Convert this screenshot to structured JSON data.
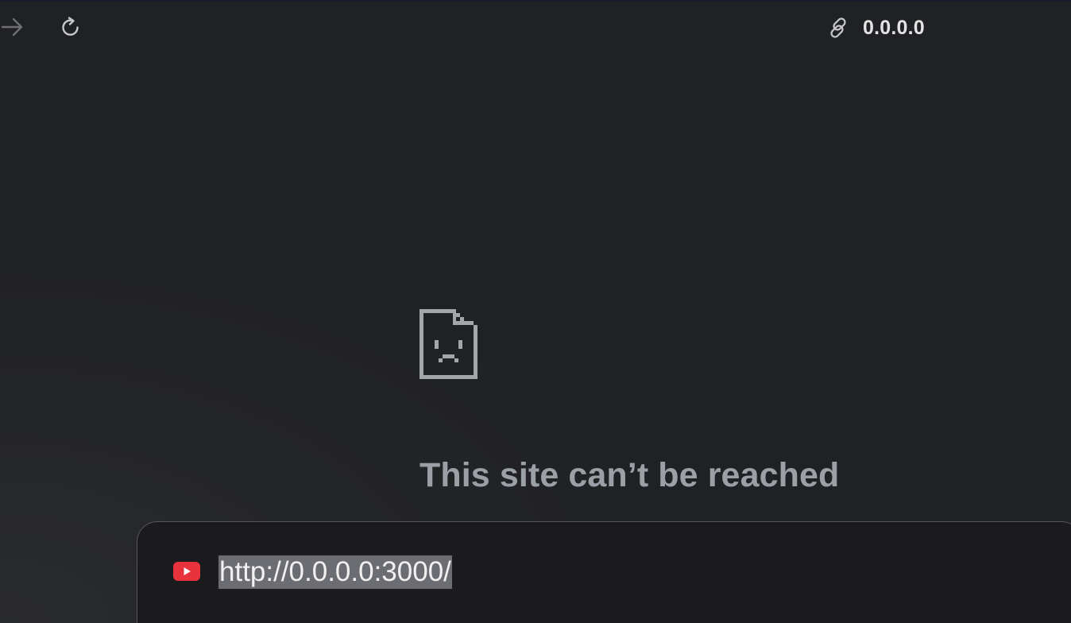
{
  "toolbar": {
    "forward_icon": "arrow-right-icon",
    "reload_icon": "reload-icon",
    "site_info_icon": "link-icon",
    "host": "0.0.0.0"
  },
  "error": {
    "icon": "sad-page-icon",
    "title": "This site can’t be reached"
  },
  "omnibox": {
    "favicon": "youtube-icon",
    "url": "http://0.0.0.0:3000/",
    "url_selected": true
  },
  "colors": {
    "background": "#202124",
    "error_title": "#9aa0a6",
    "host_text": "#e3e3e3",
    "youtube_red": "#e8323c",
    "selection": "#6b6d72"
  }
}
